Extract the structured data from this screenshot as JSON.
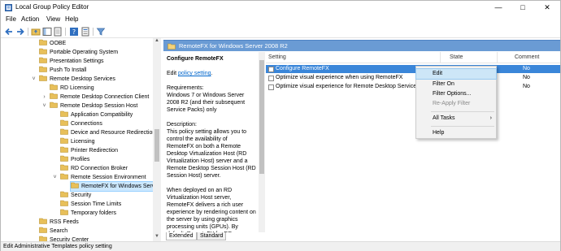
{
  "window": {
    "title": "Local Group Policy Editor"
  },
  "menu": [
    "File",
    "Action",
    "View",
    "Help"
  ],
  "toolbar_icons": [
    "back-icon",
    "forward-icon",
    "folder-up-icon",
    "show-hide-tree-icon",
    "export-list-icon",
    "help-icon",
    "properties-icon",
    "filter-icon"
  ],
  "tree": [
    {
      "label": "OOBE",
      "level": 0,
      "exp": ""
    },
    {
      "label": "Portable Operating System",
      "level": 0,
      "exp": ""
    },
    {
      "label": "Presentation Settings",
      "level": 0,
      "exp": ""
    },
    {
      "label": "Push To Install",
      "level": 0,
      "exp": ""
    },
    {
      "label": "Remote Desktop Services",
      "level": 0,
      "exp": "v"
    },
    {
      "label": "RD Licensing",
      "level": 1,
      "exp": ""
    },
    {
      "label": "Remote Desktop Connection Client",
      "level": 1,
      "exp": ">"
    },
    {
      "label": "Remote Desktop Session Host",
      "level": 1,
      "exp": "v"
    },
    {
      "label": "Application Compatibility",
      "level": 2,
      "exp": ""
    },
    {
      "label": "Connections",
      "level": 2,
      "exp": ""
    },
    {
      "label": "Device and Resource Redirection",
      "level": 2,
      "exp": ""
    },
    {
      "label": "Licensing",
      "level": 2,
      "exp": ""
    },
    {
      "label": "Printer Redirection",
      "level": 2,
      "exp": ""
    },
    {
      "label": "Profiles",
      "level": 2,
      "exp": ""
    },
    {
      "label": "RD Connection Broker",
      "level": 2,
      "exp": ""
    },
    {
      "label": "Remote Session Environment",
      "level": 2,
      "exp": "v"
    },
    {
      "label": "RemoteFX for Windows Server",
      "level": 3,
      "exp": "",
      "selected": true
    },
    {
      "label": "Security",
      "level": 2,
      "exp": ""
    },
    {
      "label": "Session Time Limits",
      "level": 2,
      "exp": ""
    },
    {
      "label": "Temporary folders",
      "level": 2,
      "exp": ""
    },
    {
      "label": "RSS Feeds",
      "level": 0,
      "exp": ""
    },
    {
      "label": "Search",
      "level": 0,
      "exp": ""
    },
    {
      "label": "Security Center",
      "level": 0,
      "exp": ""
    }
  ],
  "pane_header": "RemoteFX for Windows Server 2008 R2",
  "description": {
    "title": "Configure RemoteFX",
    "edit_prefix": "Edit ",
    "edit_link": "policy setting",
    "edit_suffix": ".",
    "body": "Requirements:\nWindows 7 or Windows Server 2008 R2 (and their subsequent Service Packs) only\n\nDescription:\nThis policy setting allows you to control the availability of RemoteFX on both a Remote Desktop Virtualization Host (RD Virtualization Host) server and a Remote Desktop Session Host (RD Session Host) server.\n\nWhen deployed on an RD Virtualization Host server, RemoteFX delivers a rich user experience by rendering content on the server by using graphics processing units (GPUs). By default, RemoteFX for RD"
  },
  "columns": {
    "setting": "Setting",
    "state": "State",
    "comment": "Comment"
  },
  "settings": [
    {
      "name": "Configure RemoteFX",
      "state": "",
      "comment": "No",
      "selected": true
    },
    {
      "name": "Optimize visual experience when using RemoteFX",
      "state": "",
      "comment": "No"
    },
    {
      "name": "Optimize visual experience for Remote Desktop Service S",
      "state": "",
      "comment": "No"
    }
  ],
  "tabs": [
    "Extended",
    "Standard"
  ],
  "status": "Edit Administrative Templates policy setting",
  "context_menu": {
    "edit": "Edit",
    "filter_on": "Filter On",
    "filter_options": "Filter Options...",
    "reapply_filter": "Re-Apply Filter",
    "all_tasks": "All Tasks",
    "help": "Help",
    "submenu_arrow": "›"
  },
  "colors": {
    "header_blue": "#6a9bd4",
    "selection_blue": "#3a86d9",
    "folder_yellow": "#e8c05a"
  }
}
